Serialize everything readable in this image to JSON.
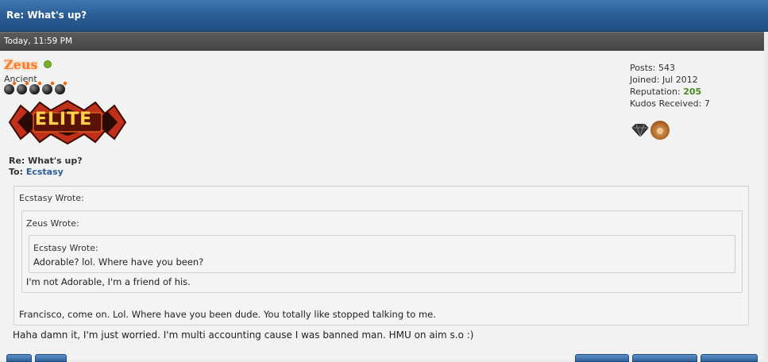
{
  "thread": {
    "title": "Re: What's up?"
  },
  "post": {
    "date": "Today, 11:59 PM",
    "author": {
      "username": "Zeus",
      "online": true,
      "rank_title": "Ancient",
      "rank_stars": 5,
      "badge_text": "ELITE"
    },
    "stats": {
      "posts_label": "Posts:",
      "posts_value": "543",
      "joined_label": "Joined:",
      "joined_value": "Jul 2012",
      "reputation_label": "Reputation:",
      "reputation_value": "205",
      "kudos_label": "Kudos Received:",
      "kudos_value": "7"
    },
    "awards": [
      "diamond-icon",
      "lion-icon"
    ],
    "subject": "Re: What's up?",
    "to_label": "To:",
    "to_user": "Ecstasy",
    "quotes": {
      "outer_header": "Ecstasy Wrote:",
      "outer_body": "Francisco, come on. Lol. Where have you been dude. You totally like stopped talking to me.",
      "middle_header": "Zeus Wrote:",
      "middle_body": "I'm not Adorable, I'm a friend of his.",
      "inner_header": "Ecstasy Wrote:",
      "inner_body": "Adorable? lol. Where have you been?"
    },
    "message": "Haha damn it, I'm just worried. I'm multi accounting cause I was banned man. HMU on aim s.o :)"
  },
  "colors": {
    "title_bar": "#2b5d94",
    "date_bar": "#4a4a4a",
    "username": "#ff7a2a",
    "reputation": "#4a8a1a",
    "link": "#2b5d94"
  }
}
